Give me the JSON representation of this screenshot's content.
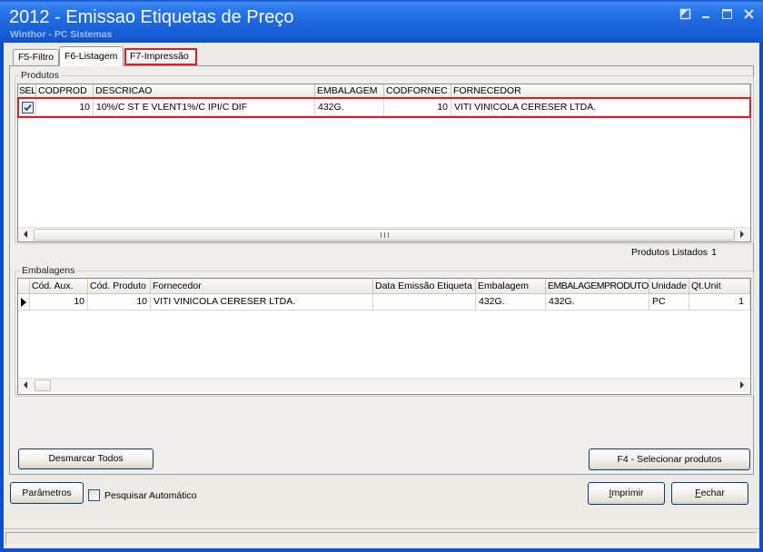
{
  "window": {
    "title": "2012 - Emissao Etiquetas de Preço",
    "subtitle": "Winthor - PC Sistemas",
    "controls": [
      "window-menu-icon",
      "minimize-icon",
      "maximize-icon",
      "close-icon"
    ]
  },
  "tabs": [
    {
      "label": "F5-Filtro",
      "active": false,
      "highlighted": false
    },
    {
      "label": "F6-Listagem",
      "active": true,
      "highlighted": false
    },
    {
      "label": "F7-Impressão",
      "active": false,
      "highlighted": true
    }
  ],
  "produtos": {
    "group_label": "Produtos",
    "columns": [
      "SEL",
      "CODPROD",
      "DESCRICAO",
      "EMBALAGEM",
      "CODFORNEC",
      "FORNECEDOR"
    ],
    "rows": [
      {
        "sel": true,
        "highlighted": true,
        "codprod": "10",
        "descricao": "10%/C ST E VLENT1%/C IPI/C DIF",
        "embalagem": "432G.",
        "codfornec": "10",
        "fornecedor": "VITI VINICOLA CERESER LTDA."
      }
    ],
    "count_label": "Produtos Listados",
    "count": "1"
  },
  "embalagens": {
    "group_label": "Embalagens",
    "columns": [
      "Cód. Aux.",
      "Cód. Produto",
      "Fornecedor",
      "Data Emissão Etiqueta",
      "Embalagem",
      "EMBALAGEMPRODUTO",
      "Unidade",
      "Qt.Unit"
    ],
    "rows": [
      {
        "current": true,
        "cod_aux": "10",
        "cod_produto": "10",
        "fornecedor": "VITI VINICOLA CERESER LTDA.",
        "data_emissao_etiqueta": "",
        "embalagem": "432G.",
        "embalagem_produto": "432G.",
        "unidade": "PC",
        "qt_unit": "1"
      }
    ]
  },
  "buttons": {
    "desmarcar": "Desmarcar Todos",
    "selecionar": "F4 - Selecionar produtos",
    "parametros": "Parâmetros",
    "imprimir": "Imprimir",
    "fechar": "Fechar"
  },
  "pesquisar_automatico": {
    "label": "Pesquisar Automático",
    "checked": false
  },
  "icons": {
    "row_select": "checkbox-checked-icon",
    "current_row": "current-row-indicator-icon",
    "scroll_left": "scroll-left-arrow-icon",
    "scroll_right": "scroll-right-arrow-icon"
  },
  "colors": {
    "titlebar": "#1c66de",
    "window_frame": "#0c4fd0",
    "window_bg": "#ecebe6",
    "annotation_highlight": "#e31b23",
    "button_border": "#003c74"
  }
}
